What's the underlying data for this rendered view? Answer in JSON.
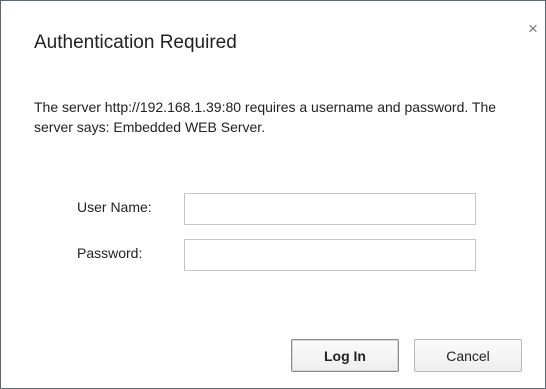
{
  "dialog": {
    "title": "Authentication Required",
    "close_glyph": "×",
    "close_icon": "close-icon",
    "message": "The server http://192.168.1.39:80 requires a username and password. The server says: Embedded WEB Server.",
    "username_label": "User Name:",
    "username_value": "",
    "password_label": "Password:",
    "password_value": "",
    "login_label": "Log In",
    "cancel_label": "Cancel"
  },
  "colors": {
    "border": "#5a6877",
    "text": "#222222",
    "close_icon": "#7a7a7a",
    "input_border": "#c6c6c6",
    "button_border": "#b8b8b8"
  }
}
